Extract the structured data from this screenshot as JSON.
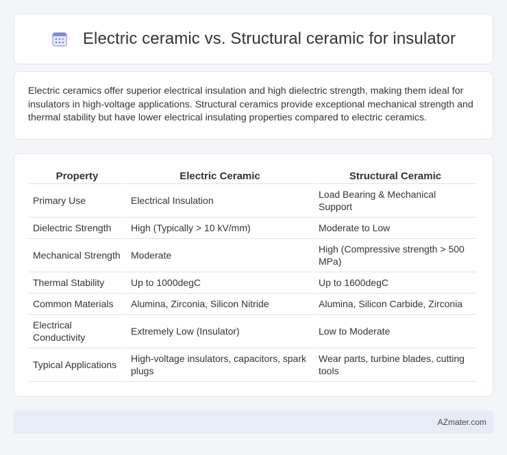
{
  "header": {
    "title": "Electric ceramic vs. Structural ceramic for insulator",
    "icon": "calendar-icon"
  },
  "summary": {
    "text": "Electric ceramics offer superior electrical insulation and high dielectric strength, making them ideal for insulators in high-voltage applications. Structural ceramics provide exceptional mechanical strength and thermal stability but have lower electrical insulating properties compared to electric ceramics."
  },
  "table": {
    "headers": [
      "Property",
      "Electric Ceramic",
      "Structural Ceramic"
    ],
    "rows": [
      [
        "Primary Use",
        "Electrical Insulation",
        "Load Bearing & Mechanical Support"
      ],
      [
        "Dielectric Strength",
        "High (Typically > 10 kV/mm)",
        "Moderate to Low"
      ],
      [
        "Mechanical Strength",
        "Moderate",
        "High (Compressive strength > 500 MPa)"
      ],
      [
        "Thermal Stability",
        "Up to 1000degC",
        "Up to 1600degC"
      ],
      [
        "Common Materials",
        "Alumina, Zirconia, Silicon Nitride",
        "Alumina, Silicon Carbide, Zirconia"
      ],
      [
        "Electrical Conductivity",
        "Extremely Low (Insulator)",
        "Low to Moderate"
      ],
      [
        "Typical Applications",
        "High-voltage insulators, capacitors, spark plugs",
        "Wear parts, turbine blades, cutting tools"
      ]
    ]
  },
  "footer": {
    "brand": "AZmater.com"
  },
  "colors": {
    "page_bg": "#f3f5f9",
    "card_bg": "#ffffff",
    "icon_accent": "#6b7fe0",
    "footer_bg": "#e7ecf6"
  }
}
